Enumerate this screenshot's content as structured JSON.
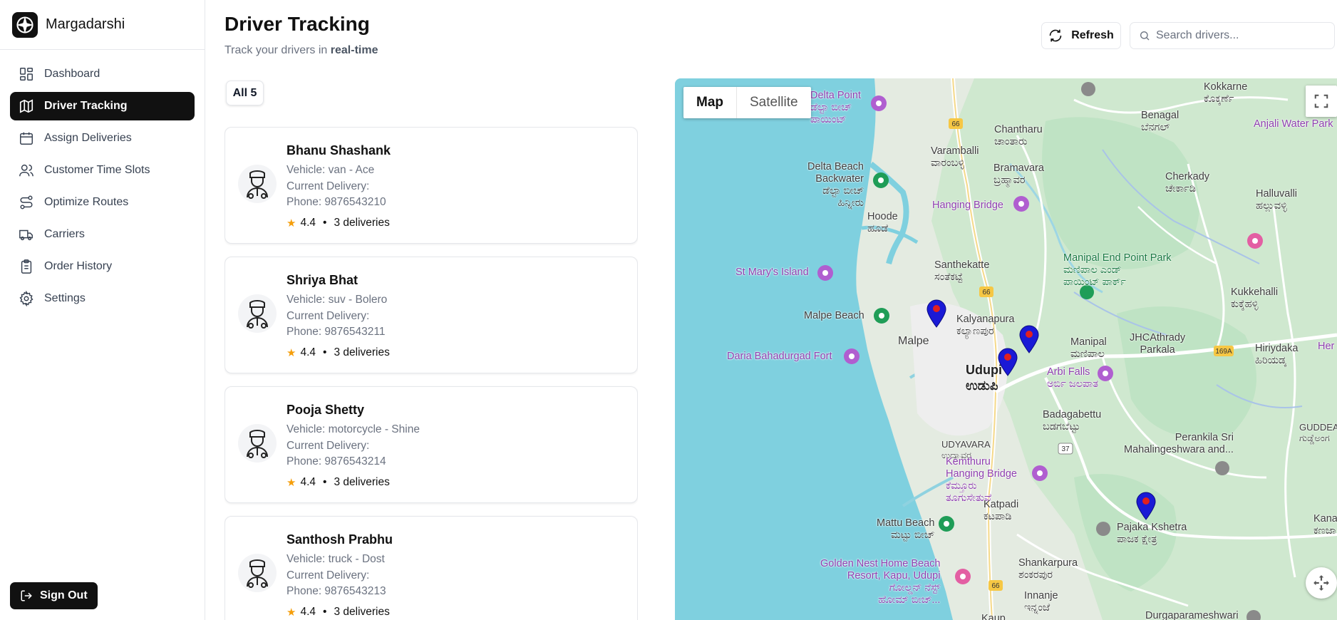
{
  "brand": {
    "name": "Margadarshi"
  },
  "nav": {
    "items": [
      {
        "label": "Dashboard",
        "icon": "dashboard-icon",
        "active": false
      },
      {
        "label": "Driver Tracking",
        "icon": "map-icon",
        "active": true
      },
      {
        "label": "Assign Deliveries",
        "icon": "calendar-icon",
        "active": false
      },
      {
        "label": "Customer Time Slots",
        "icon": "users-icon",
        "active": false
      },
      {
        "label": "Optimize Routes",
        "icon": "route-icon",
        "active": false
      },
      {
        "label": "Carriers",
        "icon": "truck-icon",
        "active": false
      },
      {
        "label": "Order History",
        "icon": "clipboard-icon",
        "active": false
      },
      {
        "label": "Settings",
        "icon": "gear-icon",
        "active": false
      }
    ],
    "signout_label": "Sign Out"
  },
  "header": {
    "title": "Driver Tracking",
    "subtitle_prefix": "Track your drivers in ",
    "subtitle_emphasis": "real-time",
    "refresh_label": "Refresh",
    "search_placeholder": "Search drivers..."
  },
  "filter": {
    "label": "All 5"
  },
  "drivers": [
    {
      "name": "Bhanu Shashank",
      "vehicle": "Vehicle: van - Ace",
      "current_delivery": "Current Delivery:",
      "phone": "Phone: 9876543210",
      "rating": "4.4",
      "deliveries": "3 deliveries"
    },
    {
      "name": "Shriya Bhat",
      "vehicle": "Vehicle: suv - Bolero",
      "current_delivery": "Current Delivery:",
      "phone": "Phone: 9876543211",
      "rating": "4.4",
      "deliveries": "3 deliveries"
    },
    {
      "name": "Pooja Shetty",
      "vehicle": "Vehicle: motorcycle - Shine",
      "current_delivery": "Current Delivery:",
      "phone": "Phone: 9876543214",
      "rating": "4.4",
      "deliveries": "3 deliveries"
    },
    {
      "name": "Santhosh Prabhu",
      "vehicle": "Vehicle: truck - Dost",
      "current_delivery": "Current Delivery:",
      "phone": "Phone: 9876543213",
      "rating": "4.4",
      "deliveries": "3 deliveries"
    }
  ],
  "map": {
    "toggle": {
      "map": "Map",
      "satellite": "Satellite"
    },
    "places": {
      "delta_point": "Delta Point\nಡೆಲ್ಟಾ ಬೀಚ್\nಪಾಯಿಂಟ್",
      "delta_beach": "Delta Beach\nBackwater\nಡೆಲ್ಟಾ ಬೀಚ್\nಹಿನ್ನೀರು",
      "hoode": "Hoode\nಹೂಡೆ",
      "chantharu": "Chantharu\nಚಾಂತಾರು",
      "varamballi": "Varamballi\nವಾರಂಬಳ್ಳಿ",
      "bramavara": "Bramavara\nಬ್ರಹ್ಮಾವರ",
      "hanging_bridge": "Hanging Bridge",
      "kokkarne": "Kokkarne\nಕೊಕ್ಕರ್ಣೆ",
      "benagal": "Benagal\nಬೆನಗಲ್",
      "anjali": "Anjali Water Park",
      "cherkady": "Cherkady\nಚೇರ್ಕಾಡಿ",
      "halluvalli": "Halluvalli\nಹಲ್ಲುವಳ್ಳಿ",
      "st_marys": "St Mary's Island",
      "santhekatte": "Santhekatte\nಸಂತೆಕಟ್ಟೆ",
      "manipal_end": "Manipal End Point Park\nಮಣಿಪಾಲ ಎಂಡ್\nಪಾಯಿಂಟ್ ಪಾರ್ಕ್",
      "kukkehalli": "Kukkehalli\nಕುಕ್ಕೆಹಳ್ಳಿ",
      "malpe_beach": "Malpe Beach",
      "kalyanapura": "Kalyanapura\nಕಲ್ಯಾಣಪುರ",
      "malpe": "Malpe",
      "manipal": "Manipal\nಮಣಿಪಾಲ",
      "jhcathrady": "JHCAthrady\nParkala",
      "hiriydaka": "Hiriydaka\nಹಿರಿಯಡ್ಕ",
      "daria": "Daria Bahadurgad Fort",
      "udupi": "Udupi\nಉಡುಪಿ",
      "arbi": "Arbi Falls\nಅರ್ಬಿ ಜಲಪಾತ",
      "badagabettu": "Badagabettu\nಬಡಗಬೆಟ್ಟು",
      "guddeangadi": "GUDDEANGA\nಗುಡ್ಡೆಅಂಗ",
      "udyavara": "UDYAVARA\nಉದ್ಯಾವರ",
      "perankila": "Perankila Sri\nMahalingeshwara and...",
      "kemthuru": "Kemthuru\nHanging Bridge\nಕೆಮ್ತೂರು\nತೂಗುಸೇತುವೆ",
      "katpadi": "Katpadi\nಕಟಪಾಡಿ",
      "pajaka": "Pajaka Kshetra\nಪಾಜಕ ಕ್ಷೇತ್ರ",
      "kanaj": "Kanaj\nಕಣಜಾ",
      "mattu": "Mattu Beach\nಮಟ್ಟು ಬೀಚ್",
      "golden_nest": "Golden Nest Home Beach\nResort, Kapu, Udupi\nಗೋಲ್ಡನ್ ನೆಸ್ಟ್\nಹೋಮ್ ಬೀಚ್...",
      "shankarpura": "Shankarpura\nಶಂಕರಪುರ",
      "innanje": "Innanje\nಇನ್ನಂಜೆ",
      "durgaparameshwari": "Durgaparameshwari",
      "kaup": "Kaup",
      "her": "Her"
    },
    "route_shields": [
      "66",
      "66",
      "66",
      "37",
      "169A"
    ],
    "colors": {
      "water": "#7fd0df",
      "land": "#e4ebe1",
      "green": "#bfe3c4",
      "road": "#ffffff",
      "pin": "#1a1ad6",
      "pin_dot": "#e02020"
    }
  }
}
